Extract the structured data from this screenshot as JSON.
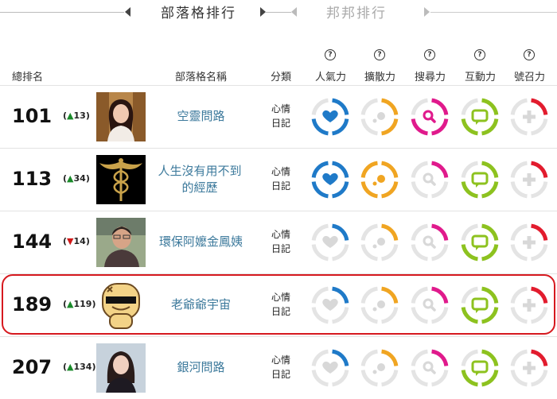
{
  "tabs": {
    "active": "部落格排行",
    "inactive": "邦邦排行"
  },
  "columns": {
    "rank": "總排名",
    "blog_name": "部落格名稱",
    "category": "分類",
    "metrics": [
      "人氣力",
      "擴散力",
      "搜尋力",
      "互動力",
      "號召力"
    ],
    "help_symbol": "?"
  },
  "metric_colors": [
    "#1f7ac8",
    "#f0a522",
    "#e01a8c",
    "#8dc21f",
    "#e21c2e"
  ],
  "rows": [
    {
      "rank": "101",
      "arrow": "▲",
      "change": "13",
      "dir": "up",
      "name": "空靈問路",
      "cat1": "心情",
      "cat2": "日記",
      "levels": [
        0.75,
        0.5,
        0.75,
        0.75,
        0.25
      ],
      "thumb": "woman-portrait"
    },
    {
      "rank": "113",
      "arrow": "▲",
      "change": "34",
      "dir": "up",
      "name": "人生沒有用不到的經歷",
      "cat1": "心情",
      "cat2": "日記",
      "levels": [
        1.0,
        1.0,
        0.25,
        0.75,
        0.25
      ],
      "thumb": "caduceus"
    },
    {
      "rank": "144",
      "arrow": "▼",
      "change": "14",
      "dir": "down",
      "name": "環保阿嬤金鳳姨",
      "cat1": "心情",
      "cat2": "日記",
      "levels": [
        0.25,
        0.25,
        0.25,
        0.75,
        0.25
      ],
      "thumb": "older-person-portrait"
    },
    {
      "rank": "189",
      "arrow": "▲",
      "change": "119",
      "dir": "up",
      "name": "老爺爺宇宙",
      "cat1": "心情",
      "cat2": "日記",
      "levels": [
        0.25,
        0.25,
        0.25,
        0.75,
        0.25
      ],
      "thumb": "cartoon-face"
    },
    {
      "rank": "207",
      "arrow": "▲",
      "change": "134",
      "dir": "up",
      "name": "銀河問路",
      "cat1": "心情",
      "cat2": "日記",
      "levels": [
        0.25,
        0.25,
        0.25,
        0.75,
        0.25
      ],
      "thumb": "woman-portrait-2"
    }
  ]
}
